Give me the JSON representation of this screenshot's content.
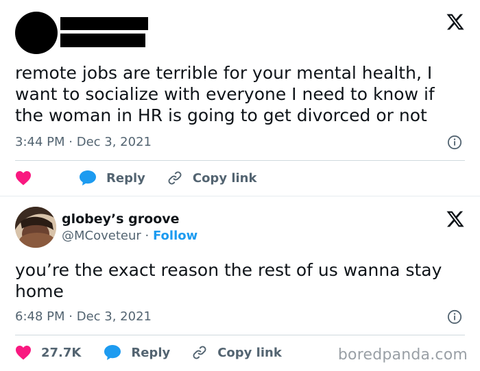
{
  "tweet1": {
    "text": "remote jobs are terrible for your mental health, I\nwant to socialize with everyone I need to know if\nthe woman in HR is going to get divorced or not",
    "time": "3:44 PM",
    "date": "Dec 3, 2021",
    "reply_label": "Reply",
    "copy_link_label": "Copy link"
  },
  "tweet2": {
    "author_name": "globey’s groove",
    "handle": "@MCoveteur",
    "follow_label": "Follow",
    "text": "you’re the exact reason the rest of us wanna stay\nhome",
    "time": "6:48 PM",
    "date": "Dec 3, 2021",
    "likes": "27.7K",
    "reply_label": "Reply",
    "copy_link_label": "Copy link"
  },
  "meta_separator": "·",
  "watermark": "boredpanda.com",
  "colors": {
    "heart": "#f91880",
    "accent": "#1d9bf0",
    "muted": "#536471",
    "text": "#0f1419"
  },
  "icons": [
    "x-logo-icon",
    "info-icon",
    "heart-icon",
    "reply-bubble-icon",
    "link-icon"
  ]
}
